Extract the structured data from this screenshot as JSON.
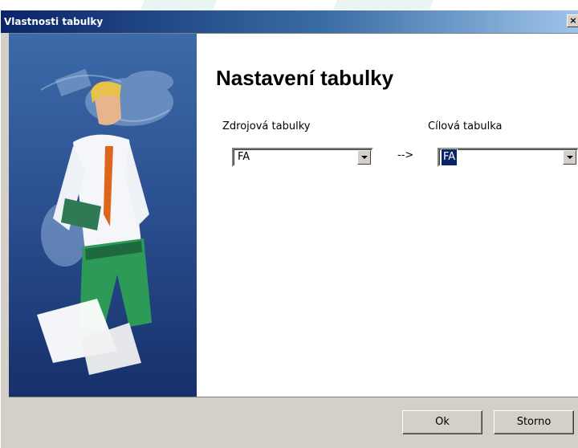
{
  "window": {
    "title": "Vlastnosti tabulky",
    "close_label": "×"
  },
  "content": {
    "heading": "Nastavení tabulky",
    "source_label": "Zdrojová tabulky",
    "target_label": "Cílová tabulka",
    "arrow_text": "-->",
    "source_value": "FA",
    "target_value": "FA"
  },
  "buttons": {
    "ok": "Ok",
    "cancel": "Storno"
  },
  "colors": {
    "title_bar": "#0a246a",
    "dialog_face": "#d4d0c8",
    "side_panel": "#1e3a7a",
    "selection": "#0a246a"
  },
  "icons": {
    "close": "close-icon",
    "dropdown": "chevron-down-icon"
  }
}
